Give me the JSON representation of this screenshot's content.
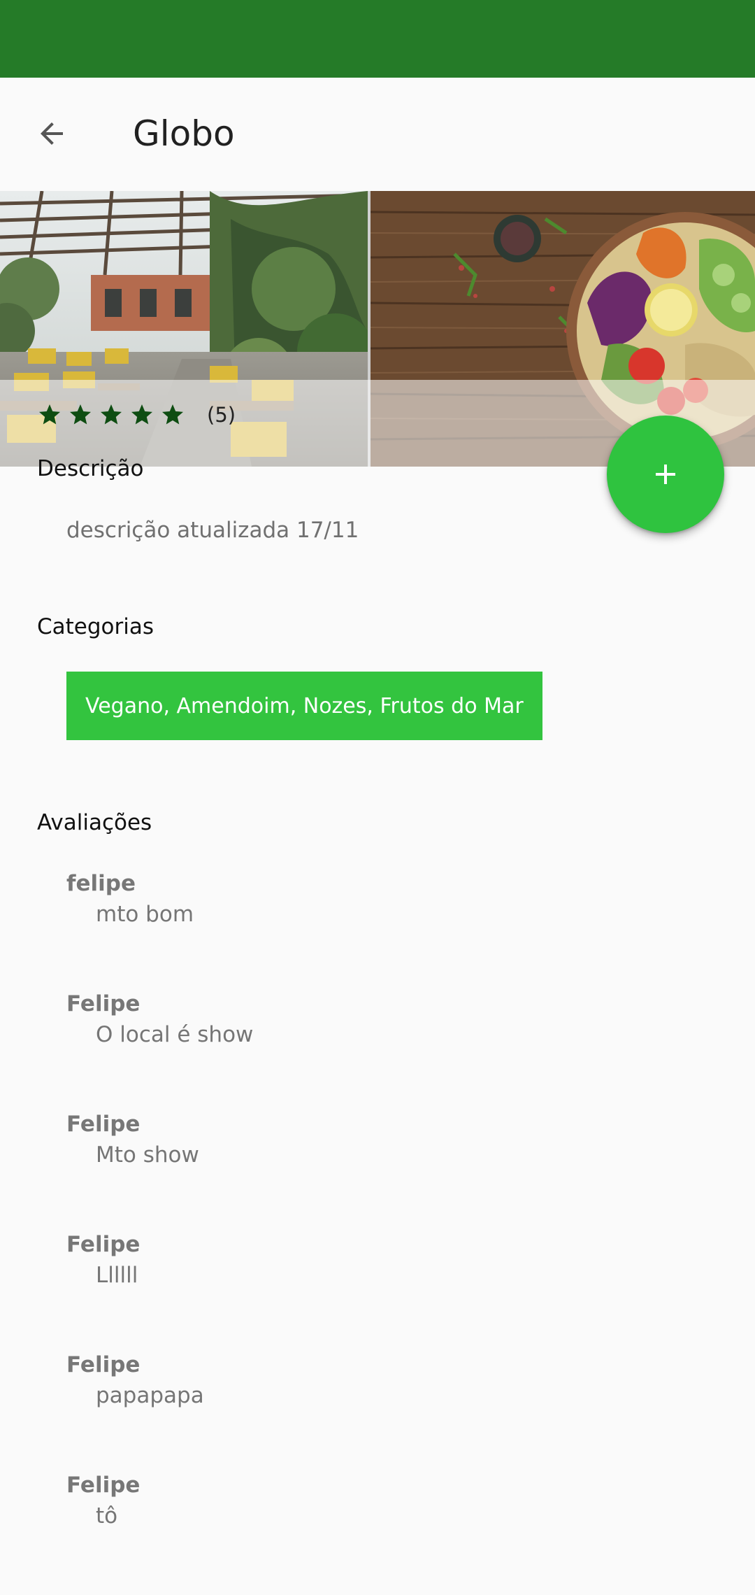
{
  "app_bar": {
    "title": "Globo",
    "back_icon": "arrow-back-icon"
  },
  "gallery": {
    "photos": [
      "restaurant-terrace-photo",
      "salad-bowl-photo"
    ],
    "rating": {
      "stars_filled": 5,
      "stars_total": 5,
      "count_label": "(5)",
      "star_color": "#0e4d12"
    }
  },
  "fab": {
    "icon": "plus-icon",
    "color": "#2fc33f"
  },
  "description": {
    "title": "Descrição",
    "text": "descrição atualizada 17/11"
  },
  "categories": {
    "title": "Categorias",
    "chip_label": "Vegano, Amendoim, Nozes, Frutos do Mar",
    "chip_color": "#33c43f"
  },
  "reviews": {
    "title": "Avaliações",
    "items": [
      {
        "author": "felipe",
        "text": "mto bom"
      },
      {
        "author": "Felipe",
        "text": "O local é show"
      },
      {
        "author": "Felipe",
        "text": "Mto show"
      },
      {
        "author": "Felipe",
        "text": "Llllll"
      },
      {
        "author": "Felipe",
        "text": "papapapa"
      },
      {
        "author": "Felipe",
        "text": "tô"
      }
    ]
  },
  "colors": {
    "status_bar": "#257b28",
    "background": "#fafafa"
  }
}
